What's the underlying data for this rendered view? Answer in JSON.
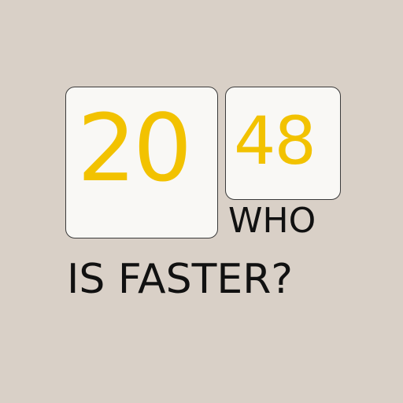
{
  "logo": {
    "number_left": "20",
    "number_right": "48"
  },
  "tagline": {
    "line1": "WHO",
    "line2": "IS FASTER?"
  },
  "colors": {
    "background": "#d9d0c7",
    "tile": "#f9f8f5",
    "tile_border": "#3b3b3b",
    "number": "#f2c200",
    "text": "#111111"
  }
}
